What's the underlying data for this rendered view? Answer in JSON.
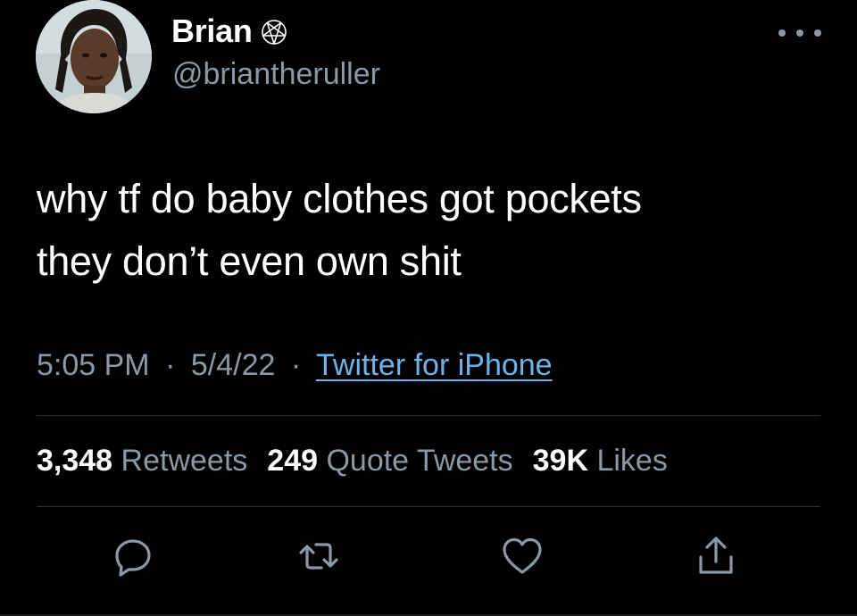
{
  "author": {
    "display_name": "Brian",
    "name_icon": "pentagram-icon",
    "handle": "@briantheruller",
    "avatar": "profile-photo"
  },
  "tweet": {
    "text_line_1": "why tf do baby clothes got pockets",
    "text_line_2": "they don’t even own shit"
  },
  "meta": {
    "time": "5:05 PM",
    "date": "5/4/22",
    "separator": "·",
    "source": "Twitter for iPhone"
  },
  "stats": {
    "retweets_count": "3,348",
    "retweets_label": "Retweets",
    "quotes_count": "249",
    "quotes_label": "Quote Tweets",
    "likes_count": "39K",
    "likes_label": "Likes"
  },
  "actions": {
    "icons": [
      "reply-icon",
      "retweet-icon",
      "like-icon",
      "share-icon"
    ]
  },
  "colors": {
    "background": "#000000",
    "primary_text": "#ffffff",
    "secondary_text": "#8b98a5",
    "link": "#6cb2eb",
    "divider": "#2f3336"
  }
}
